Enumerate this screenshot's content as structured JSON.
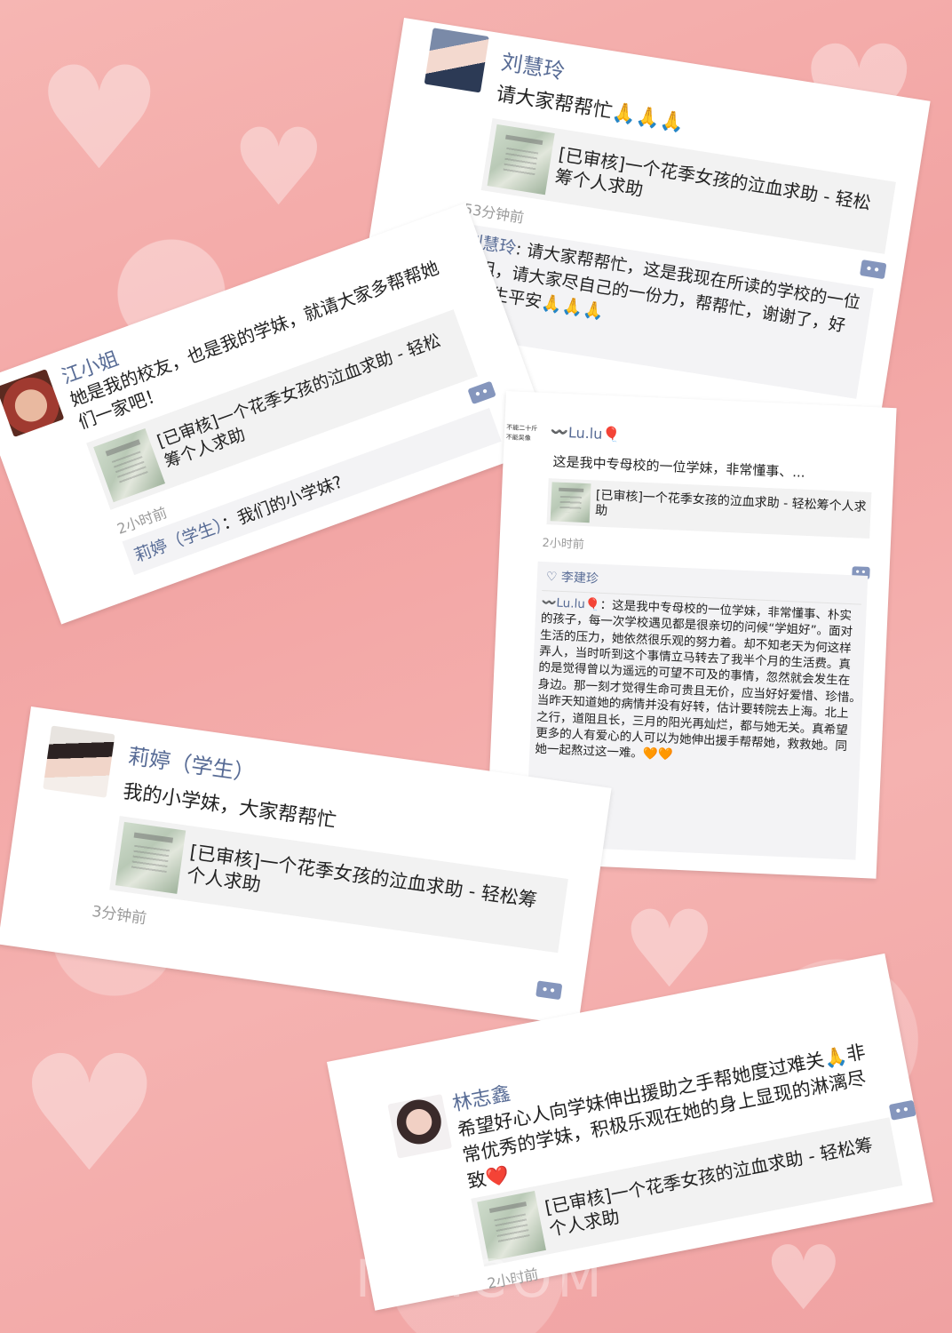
{
  "posts": [
    {
      "name": "刘慧玲",
      "text": "请大家帮帮忙🙏🙏🙏",
      "link_title": "[已审核]一个花季女孩的泣血求助 - 轻松筹个人求助",
      "time": "53分钟前",
      "comment_author": "刘慧玲",
      "comment_text": ": 请大家帮帮忙，这是我现在所读的学校的一位学姐，请大家尽自己的一份力，帮帮忙，谢谢了，好人一生平安🙏🙏🙏"
    },
    {
      "name": "江小姐",
      "text": "她是我的校友，也是我的学妹，就请大家多帮帮她们一家吧！",
      "link_title": "[已审核]一个花季女孩的泣血求助 - 轻松筹个人求助",
      "time": "2小时前",
      "comment_author": "莉婷（学生）",
      "comment_text": "：我们的小学妹?"
    },
    {
      "side_text": "不能二十斤 不能吴像",
      "name": "〰️Lu.lu🎈",
      "text": "这是我中专母校的一位学妹，非常懂事、...",
      "link_title": "[已审核]一个花季女孩的泣血求助 - 轻松筹个人求助",
      "time": "2小时前",
      "like_name": "♡ 李建珍",
      "comment_author": "〰️Lu.lu🎈",
      "comment_text": "：这是我中专母校的一位学妹，非常懂事、朴实的孩子，每一次学校遇见都是很亲切的问候“学姐好”。面对生活的压力，她依然很乐观的努力着。却不知老天为何这样弄人，当时听到这个事情立马转去了我半个月的生活费。真的是觉得曾以为遥远的可望不可及的事情，忽然就会发生在身边。那一刻才觉得生命可贵且无价，应当好好爱惜、珍惜。　　　当昨天知道她的病情并没有好转，估计要转院去上海。北上之行，道阻且长，三月的阳光再灿烂，都与她无关。真希望更多的人有爱心的人可以为她伸出援手帮帮她，救救她。同她一起熬过这一难。🧡🧡"
    },
    {
      "name": "莉婷（学生）",
      "text": "我的小学妹，大家帮帮忙",
      "link_title": "[已审核]一个花季女孩的泣血求助 - 轻松筹个人求助",
      "time": "3分钟前"
    },
    {
      "name": "林志鑫",
      "text": "希望好心人向学妹伸出援助之手帮她度过难关🙏非常优秀的学妹，积极乐观在她的身上显现的淋漓尽致❤️",
      "link_title": "[已审核]一个花季女孩的泣血求助 - 轻松筹个人求助",
      "time": "2小时前"
    }
  ],
  "icons": {
    "comment": "comment-icon",
    "avatar": "avatar"
  },
  "watermark": "M...COM",
  "colors": {
    "name": "#576b95",
    "comment_icon": "#8596bd",
    "background": "#f2a4a3"
  }
}
